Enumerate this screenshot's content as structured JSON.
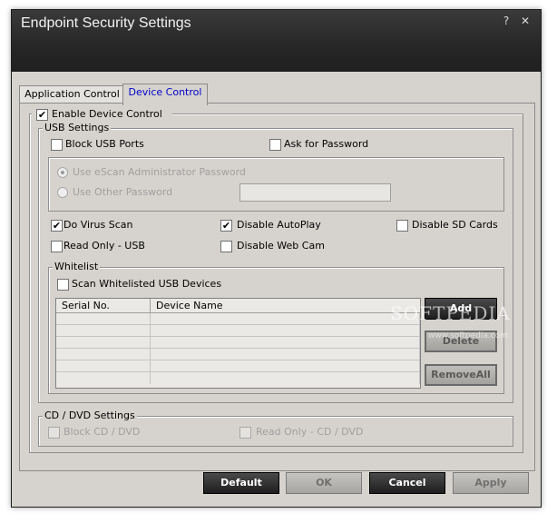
{
  "window": {
    "title": "Endpoint Security Settings",
    "help_glyph": "?",
    "close_glyph": "✕"
  },
  "tabs": [
    {
      "label": "Application Control",
      "active": false
    },
    {
      "label": "Device Control",
      "active": true
    }
  ],
  "enable_device_control": {
    "label": "Enable Device Control",
    "checked": true
  },
  "usb_settings": {
    "group_label": "USB Settings",
    "block_usb_ports": {
      "label": "Block USB Ports",
      "checked": false
    },
    "ask_for_password": {
      "label": "Ask for Password",
      "checked": false
    },
    "radio_admin_password": {
      "label": "Use eScan Administrator Password",
      "selected": true,
      "enabled": false
    },
    "radio_other_password": {
      "label": "Use Other Password",
      "selected": false,
      "enabled": false
    },
    "other_password_value": "",
    "do_virus_scan": {
      "label": "Do Virus Scan",
      "checked": true
    },
    "disable_autoplay": {
      "label": "Disable AutoPlay",
      "checked": true
    },
    "disable_sd_cards": {
      "label": "Disable SD Cards",
      "checked": false
    },
    "read_only_usb": {
      "label": "Read Only - USB",
      "checked": false
    },
    "disable_web_cam": {
      "label": "Disable Web Cam",
      "checked": false
    }
  },
  "whitelist": {
    "group_label": "Whitelist",
    "scan_whitelisted": {
      "label": "Scan Whitelisted USB Devices",
      "checked": false
    },
    "columns": [
      "Serial No.",
      "Device Name"
    ],
    "rows": [],
    "buttons": {
      "add": "Add",
      "delete": "Delete",
      "remove_all": "RemoveAll"
    }
  },
  "cd_dvd": {
    "group_label": "CD / DVD Settings",
    "block_cd_dvd": {
      "label": "Block CD / DVD",
      "checked": false,
      "enabled": false
    },
    "read_only_cd_dvd": {
      "label": "Read Only - CD / DVD",
      "checked": false,
      "enabled": false
    }
  },
  "footer_buttons": {
    "default": "Default",
    "ok": "OK",
    "cancel": "Cancel",
    "apply": "Apply"
  },
  "watermark": {
    "text": "SOFTPEDIA",
    "url": "www.softpedia.com"
  },
  "colors": {
    "titlebar": "#262626",
    "panel": "#d6d3ce",
    "active_tab_text": "#0000cc"
  }
}
